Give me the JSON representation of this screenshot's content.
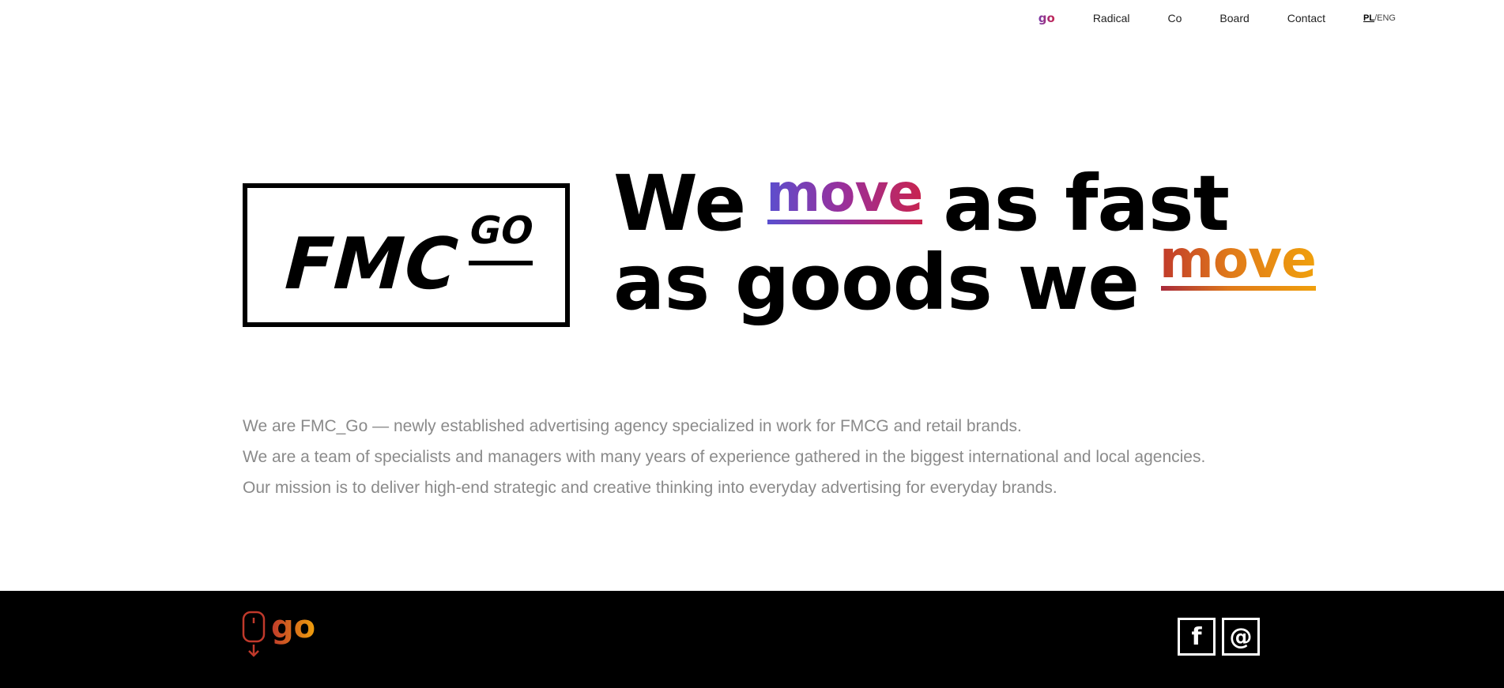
{
  "nav": {
    "items": [
      {
        "label": "go",
        "active": true
      },
      {
        "label": "Radical"
      },
      {
        "label": "Co"
      },
      {
        "label": "Board"
      },
      {
        "label": "Contact"
      }
    ],
    "lang_pl": "PL",
    "lang_sep": "/",
    "lang_eng": "ENG"
  },
  "logo": {
    "main": "FMC",
    "sup": "GO"
  },
  "headline": {
    "line1_a": "We",
    "line1_move": "move",
    "line1_b": "as fast",
    "line2_a": "as goods we",
    "line2_move": "move"
  },
  "intro": {
    "line1": "We are FMC_Go — newly established advertising agency specialized in work for FMCG and retail brands.",
    "line2": "We are a team of specialists and managers with many years of experience gathered in the biggest international and local agencies.",
    "line3": "Our mission is to deliver high-end strategic and creative thinking into everyday advertising for everyday brands."
  },
  "footer": {
    "go_label": "go",
    "facebook_glyph": "f",
    "email_glyph": "@"
  },
  "colors": {
    "move1_gradient": [
      "#5a4fcf",
      "#9a2f9a",
      "#c8244f"
    ],
    "move2_gradient": [
      "#a82a3a",
      "#e07a1a",
      "#f0a00c"
    ],
    "intro_text": "#8a8a8a",
    "footer_bg": "#000000"
  }
}
